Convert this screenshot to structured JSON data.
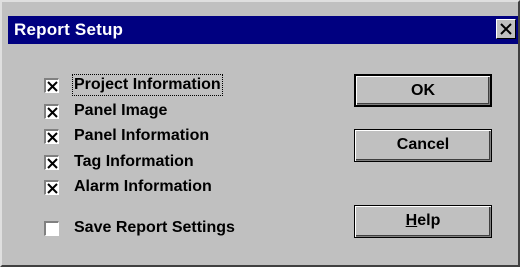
{
  "dialog": {
    "title": "Report Setup",
    "close_glyph": "✕"
  },
  "options": [
    {
      "label": "Project Information",
      "checked": true
    },
    {
      "label": "Panel Image",
      "checked": true
    },
    {
      "label": "Panel Information",
      "checked": true
    },
    {
      "label": "Tag Information",
      "checked": true
    },
    {
      "label": "Alarm Information",
      "checked": true
    },
    {
      "label": "Save Report Settings",
      "checked": false
    }
  ],
  "buttons": {
    "ok": "OK",
    "cancel": "Cancel",
    "help_mnemonic": "H",
    "help_rest": "elp"
  }
}
